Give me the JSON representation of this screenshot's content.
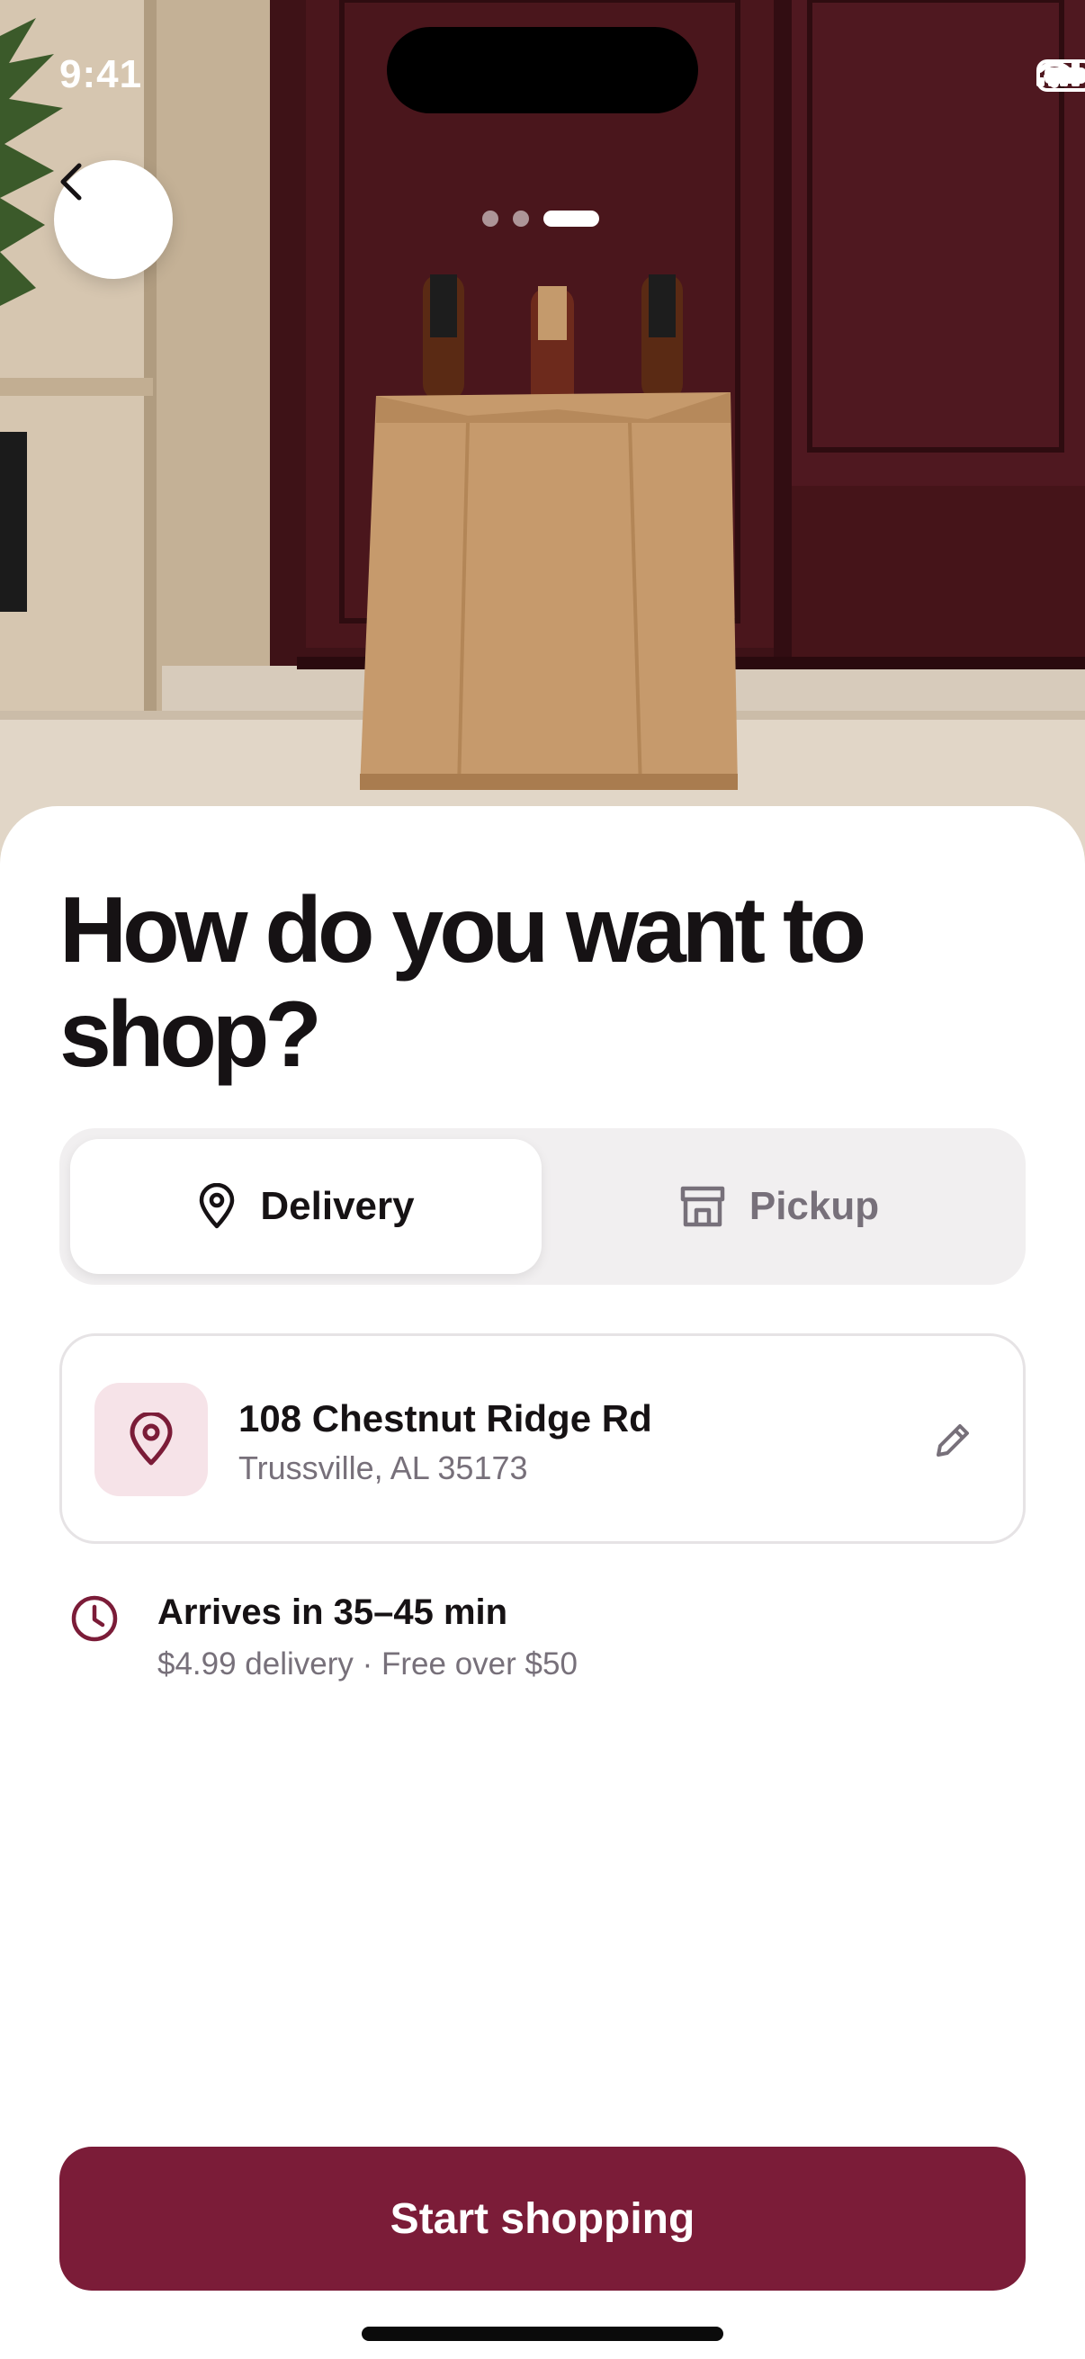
{
  "status_bar": {
    "time": "9:41"
  },
  "hero": {
    "back_icon": "chevron-left-icon",
    "page_indicator": {
      "count": 3,
      "active_index": 2
    }
  },
  "main": {
    "title": "How do you want to shop?",
    "mode_segment": {
      "options": [
        {
          "label": "Delivery",
          "icon": "location-pin-icon",
          "selected": true
        },
        {
          "label": "Pickup",
          "icon": "store-icon",
          "selected": false
        }
      ]
    },
    "address": {
      "line1": "108 Chestnut Ridge Rd",
      "line2": "Trussville, AL 35173",
      "icon": "location-pin-icon",
      "edit_icon": "pencil-icon"
    },
    "eta": {
      "title": "Arrives in 35–45 min",
      "subtitle": "$4.99 delivery · Free over $50",
      "icon": "clock-icon"
    }
  },
  "cta": {
    "label": "Start shopping"
  },
  "colors": {
    "accent": "#7b1c38",
    "accent_tint": "#f6e3e8",
    "text_primary": "#161214",
    "text_secondary": "#77707a",
    "segment_bg": "#f1eff0"
  }
}
